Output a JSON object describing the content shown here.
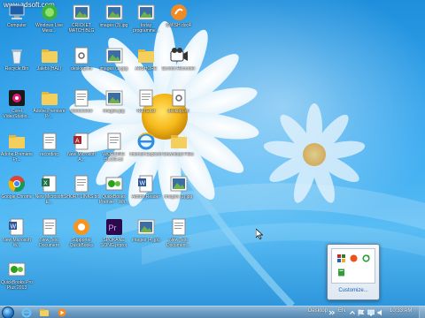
{
  "watermark": "www.zdsoft.com",
  "desktop": {
    "icons": [
      {
        "label": "Computer",
        "icon": "computer-icon"
      },
      {
        "label": "Windows Live Mess...",
        "icon": "messenger-icon"
      },
      {
        "label": "CRICKET MATCH BLG",
        "icon": "image-file-icon"
      },
      {
        "label": "images (3).jpg",
        "icon": "image-file-icon"
      },
      {
        "label": "today programme...",
        "icon": "image-file-icon"
      },
      {
        "label": "SWISH.doc4",
        "icon": "swish-icon"
      },
      {
        "label": "Recycle Bin",
        "icon": "recycle-bin-icon"
      },
      {
        "label": "Jalebi (HAL)",
        "icon": "folder-icon"
      },
      {
        "label": "desktop.ini",
        "icon": "settings-file-icon"
      },
      {
        "label": "images (1).jpg",
        "icon": "image-file-icon"
      },
      {
        "label": "AKSHORE",
        "icon": "folder-icon"
      },
      {
        "label": "Screen Recorder",
        "icon": "camera-icon"
      },
      {
        "label": "Corel VideoStudio...",
        "icon": "corel-icon"
      },
      {
        "label": "Adobe Premiere Pr...",
        "icon": "folder-icon"
      },
      {
        "label": "eeeeeeeee",
        "icon": "text-file-icon"
      },
      {
        "label": "images.jpg",
        "icon": "image-file-icon"
      },
      {
        "label": "NOTE.txt",
        "icon": "text-file-icon"
      },
      {
        "label": "desktop.ini",
        "icon": "settings-file-icon"
      },
      {
        "label": "Adobe Premiere Pr...",
        "icon": "folder-icon"
      },
      {
        "label": "recording",
        "icon": "text-file-icon"
      },
      {
        "label": "New Microsoft A...",
        "icon": "access-icon"
      },
      {
        "label": "WORKING BLOG.txt",
        "icon": "text-file-icon"
      },
      {
        "label": "Internet Explorer",
        "icon": "ie-icon"
      },
      {
        "label": "Download Files",
        "icon": "folder-icon"
      },
      {
        "label": "Google Chrome",
        "icon": "chrome-icon"
      },
      {
        "label": "New Microsoft E...",
        "icon": "excel-icon"
      },
      {
        "label": "SHORT LINKS.txt",
        "icon": "text-file-icon"
      },
      {
        "label": "QuickBooks Premier - Wh...",
        "icon": "quickbooks-icon"
      },
      {
        "label": "Adobe Reader",
        "icon": "word-doc-icon"
      },
      {
        "label": "images (2).jpg",
        "icon": "image-file-icon"
      },
      {
        "label": "New Microsoft W...",
        "icon": "word-doc-icon"
      },
      {
        "label": "New Text Document",
        "icon": "text-file-icon"
      },
      {
        "label": "Supporter QuickBooks",
        "icon": "support-icon"
      },
      {
        "label": "SPOKANE SONG.prproj",
        "icon": "premiere-icon"
      },
      {
        "label": "images (4).jpg",
        "icon": "image-file-icon"
      },
      {
        "label": "New Text Document...",
        "icon": "text-file-icon"
      },
      {
        "label": "QuickBooks Pro Plus 2013",
        "icon": "quickbooks-icon"
      }
    ]
  },
  "tray_popup": {
    "customize_label": "Customize...",
    "icons": [
      "network-monitor-icon",
      "orange-circle-icon",
      "green-refresh-icon",
      "green-doc-icon"
    ]
  },
  "taskbar": {
    "start_label": "Start",
    "pinned": [
      "ie-icon",
      "explorer-folder-icon",
      "media-player-icon"
    ],
    "desktop_label": "Desktop",
    "language": "EN",
    "time": "10:33 AM",
    "colors": {
      "accent": "#1e74c6"
    }
  }
}
